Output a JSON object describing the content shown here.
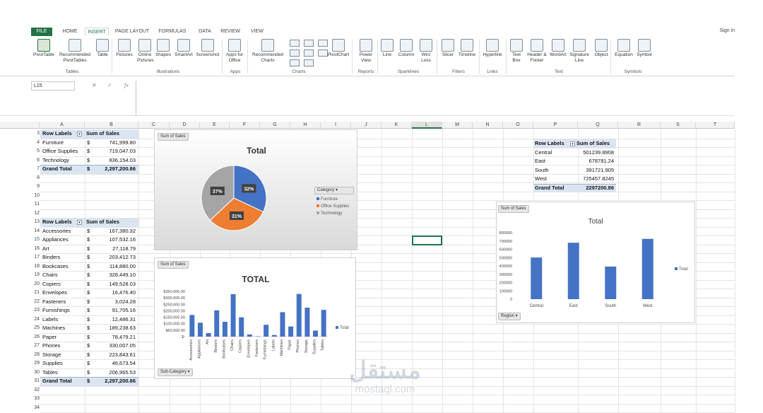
{
  "tabs": [
    "FILE",
    "HOME",
    "INSERT",
    "PAGE LAYOUT",
    "FORMULAS",
    "DATA",
    "REVIEW",
    "VIEW"
  ],
  "sign_in": "Sign in",
  "ribbon": {
    "buttons": [
      "PivotTable",
      "Recommended PivotTables",
      "Table",
      "Pictures",
      "Online Pictures",
      "Shapes",
      "SmartArt",
      "Screenshot",
      "Apps for Office",
      "Recommended Charts",
      "PivotChart",
      "Power View",
      "Line",
      "Column",
      "Win/ Loss",
      "Slicer",
      "Timeline",
      "Hyperlink",
      "Text Box",
      "Header & Footer",
      "WordArt",
      "Signature Line",
      "Object",
      "Equation",
      "Symbol"
    ],
    "groups": [
      "Tables",
      "Illustrations",
      "Apps",
      "Charts",
      "Reports",
      "Sparklines",
      "Filters",
      "Links",
      "Text",
      "Symbols"
    ]
  },
  "formula_bar": {
    "name_box": "L15",
    "fx": "fx"
  },
  "columns": [
    "A",
    "B",
    "C",
    "D",
    "E",
    "F",
    "G",
    "H",
    "I",
    "J",
    "K",
    "L",
    "M",
    "N",
    "O",
    "P",
    "Q",
    "R",
    "S",
    "T"
  ],
  "rows": [
    "3",
    "4",
    "5",
    "6",
    "7",
    "8",
    "9",
    "10",
    "11",
    "12",
    "13",
    "14",
    "15",
    "16",
    "17",
    "18",
    "19",
    "20",
    "21",
    "22",
    "23",
    "24",
    "25",
    "26",
    "27",
    "28",
    "29",
    "30",
    "31",
    "32",
    "33",
    "34"
  ],
  "pivot1": {
    "header": [
      "Row Labels",
      "Sum of Sales"
    ],
    "rows": [
      [
        "Furniture",
        "$",
        "741,999.80"
      ],
      [
        "Office Supplies",
        "$",
        "719,047.03"
      ],
      [
        "Technology",
        "$",
        "836,154.03"
      ]
    ],
    "total": [
      "Grand Total",
      "$",
      "2,297,200.86"
    ]
  },
  "pivot2": {
    "header": [
      "Row Labels",
      "Sum of Sales"
    ],
    "rows": [
      [
        "Accessories",
        "$",
        "167,380.32"
      ],
      [
        "Appliances",
        "$",
        "107,532.16"
      ],
      [
        "Art",
        "$",
        "27,118.79"
      ],
      [
        "Binders",
        "$",
        "203,412.73"
      ],
      [
        "Bookcases",
        "$",
        "114,880.00"
      ],
      [
        "Chairs",
        "$",
        "328,449.10"
      ],
      [
        "Copiers",
        "$",
        "149,528.03"
      ],
      [
        "Envelopes",
        "$",
        "16,476.40"
      ],
      [
        "Fasteners",
        "$",
        "3,024.28"
      ],
      [
        "Furnishings",
        "$",
        "91,705.16"
      ],
      [
        "Labels",
        "$",
        "12,486.31"
      ],
      [
        "Machines",
        "$",
        "189,238.63"
      ],
      [
        "Paper",
        "$",
        "78,479.21"
      ],
      [
        "Phones",
        "$",
        "330,007.05"
      ],
      [
        "Storage",
        "$",
        "223,843.61"
      ],
      [
        "Supplies",
        "$",
        "46,673.54"
      ],
      [
        "Tables",
        "$",
        "206,965.53"
      ]
    ],
    "total": [
      "Grand Total",
      "$",
      "2,297,200.86"
    ]
  },
  "pivot3": {
    "header": [
      "Row Labels",
      "Sum of Sales"
    ],
    "rows": [
      [
        "Central",
        "501239.8908"
      ],
      [
        "East",
        "678781.24"
      ],
      [
        "South",
        "391721.905"
      ],
      [
        "West",
        "725457.8245"
      ]
    ],
    "total": [
      "Grand Total",
      "2297200.86"
    ]
  },
  "watermark": {
    "arabic": "مستقل",
    "latin": "mostaql.com"
  },
  "colors": {
    "blue": "#4472c4",
    "orange": "#ed7d31",
    "gray": "#a5a5a5",
    "excel_green": "#217346"
  },
  "chart_data": [
    {
      "type": "pie",
      "title": "Total",
      "field_button": "Sum of Sales",
      "legend_title": "Category",
      "categories": [
        "Furniture",
        "Office Supplies",
        "Technology"
      ],
      "values": [
        32,
        31,
        37
      ],
      "labels": [
        "32%",
        "31%",
        "37%"
      ],
      "colors": [
        "#4472c4",
        "#ed7d31",
        "#a5a5a5"
      ],
      "legend": "right"
    },
    {
      "type": "bar",
      "title": "TOTAL",
      "field_button": "Sum of Sales",
      "axis_button": "Sub-Category",
      "series": [
        {
          "name": "Total",
          "values": [
            167380.32,
            107532.16,
            27118.79,
            203412.73,
            114880.0,
            328449.1,
            149528.03,
            16476.4,
            3024.28,
            91705.16,
            12486.31,
            189238.63,
            78479.21,
            330007.05,
            223843.61,
            46673.54,
            206965.53
          ]
        }
      ],
      "categories": [
        "Accessories",
        "Appliances",
        "Art",
        "Binders",
        "Bookcases",
        "Chairs",
        "Copiers",
        "Envelopes",
        "Fasteners",
        "Furnishings",
        "Labels",
        "Machines",
        "Paper",
        "Phones",
        "Storage",
        "Supplies",
        "Tables"
      ],
      "ylim": [
        0,
        350000
      ],
      "ticks": [
        "$350,000.00",
        "$300,000.00",
        "$250,000.00",
        "$200,000.00",
        "$150,000.00",
        "$100,000.00",
        "$50,000.00",
        "$-"
      ],
      "legend": "right"
    },
    {
      "type": "bar",
      "title": "Total",
      "field_button": "Sum of Sales",
      "axis_button": "Region",
      "series": [
        {
          "name": "Total",
          "values": [
            501239.8908,
            678781.24,
            391721.905,
            725457.8245
          ]
        }
      ],
      "categories": [
        "Central",
        "East",
        "South",
        "West"
      ],
      "ylim": [
        0,
        800000
      ],
      "ticks": [
        "800000",
        "700000",
        "600000",
        "500000",
        "400000",
        "300000",
        "200000",
        "100000",
        "0"
      ],
      "legend": "right"
    }
  ]
}
